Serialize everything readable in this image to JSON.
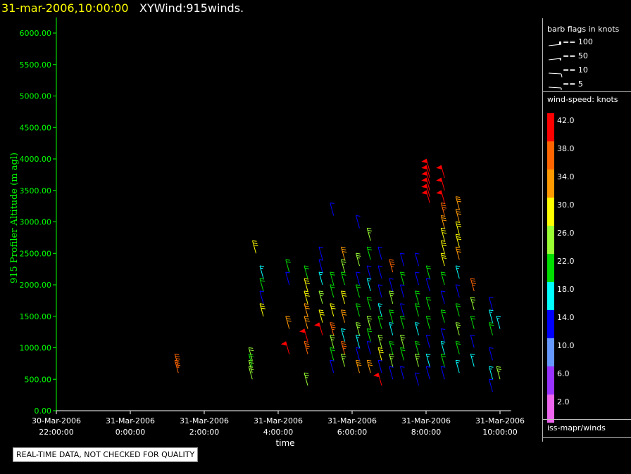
{
  "header": {
    "datetime": "31-mar-2006,10:00:00",
    "title": "XYWind:915winds."
  },
  "colors": {
    "axis": "#00ff00",
    "background": "#000000",
    "header_datetime": "#ffff00"
  },
  "legend": {
    "barb_title": "barb flags in knots",
    "barb_items": [
      "== 100",
      "== 50",
      "== 10",
      "== 5"
    ],
    "speed_title": "wind-speed: knots",
    "speed_scale": [
      {
        "label": "42.0",
        "color": "#ff0000"
      },
      {
        "label": "38.0",
        "color": "#ff6600"
      },
      {
        "label": "34.0",
        "color": "#ff9900"
      },
      {
        "label": "30.0",
        "color": "#ffff00"
      },
      {
        "label": "26.0",
        "color": "#99ff33"
      },
      {
        "label": "22.0",
        "color": "#00dd00"
      },
      {
        "label": "18.0",
        "color": "#00ffff"
      },
      {
        "label": "14.0",
        "color": "#0000ff"
      },
      {
        "label": "10.0",
        "color": "#6699ff"
      },
      {
        "label": "6.0",
        "color": "#9933ff"
      },
      {
        "label": "2.0",
        "color": "#ee66ee"
      }
    ],
    "source": "iss-mapr/winds"
  },
  "quality_note": "REAL-TIME DATA, NOT CHECKED FOR QUALITY",
  "chart_data": {
    "type": "scatter",
    "xlabel": "time",
    "ylabel": "915 Profiler Altitude (m agl)",
    "ylim": [
      0,
      6250
    ],
    "yticks": [
      0,
      500,
      1000,
      1500,
      2000,
      2500,
      3000,
      3500,
      4000,
      4500,
      5000,
      5500,
      6000
    ],
    "ytick_labels": [
      "0.00",
      "500.00",
      "1000.00",
      "1500.00",
      "2000.00",
      "2500.00",
      "3000.00",
      "3500.00",
      "4000.00",
      "4500.00",
      "5000.00",
      "5500.00",
      "6000.00"
    ],
    "xlim": [
      0,
      12.3
    ],
    "xticks": [
      {
        "hours": 0,
        "date": "30-Mar-2006",
        "time": "22:00:00"
      },
      {
        "hours": 2,
        "date": "31-Mar-2006",
        "time": "0:00:00"
      },
      {
        "hours": 4,
        "date": "31-Mar-2006",
        "time": "2:00:00"
      },
      {
        "hours": 6,
        "date": "31-Mar-2006",
        "time": "4:00:00"
      },
      {
        "hours": 8,
        "date": "31-Mar-2006",
        "time": "6:00:00"
      },
      {
        "hours": 10,
        "date": "31-Mar-2006",
        "time": "8:00:00"
      },
      {
        "hours": 12,
        "date": "31-Mar-2006",
        "time": "10:00:00"
      }
    ],
    "series": [
      {
        "time": 3.3,
        "altitudes": [
          600,
          700
        ],
        "speeds": [
          36,
          36
        ]
      },
      {
        "time": 5.3,
        "altitudes": [
          500,
          600,
          700,
          800
        ],
        "speeds": [
          24,
          24,
          22,
          24
        ]
      },
      {
        "time": 5.4,
        "altitudes": [
          2500
        ],
        "speeds": [
          30
        ]
      },
      {
        "time": 5.6,
        "altitudes": [
          1500,
          1700,
          1900,
          2100
        ],
        "speeds": [
          30,
          14,
          22,
          18
        ]
      },
      {
        "time": 6.3,
        "altitudes": [
          900,
          1300,
          2000,
          2200
        ],
        "speeds": [
          42,
          34,
          14,
          20
        ]
      },
      {
        "time": 6.8,
        "altitudes": [
          400,
          900,
          1100,
          1300,
          1500,
          1700,
          1900,
          2100
        ],
        "speeds": [
          26,
          36,
          42,
          34,
          34,
          30,
          30,
          22
        ]
      },
      {
        "time": 7.2,
        "altitudes": [
          1200,
          1400,
          1700,
          2000,
          2200,
          2400
        ],
        "speeds": [
          42,
          30,
          26,
          18,
          14,
          14
        ]
      },
      {
        "time": 7.5,
        "altitudes": [
          600,
          800,
          1000,
          1200,
          1500,
          1800,
          2000,
          3100
        ],
        "speeds": [
          14,
          22,
          26,
          38,
          30,
          22,
          20,
          14
        ]
      },
      {
        "time": 7.8,
        "altitudes": [
          700,
          900,
          1100,
          1400,
          1700,
          2000,
          2200,
          2400
        ],
        "speeds": [
          26,
          38,
          18,
          34,
          30,
          22,
          26,
          34
        ]
      },
      {
        "time": 8.2,
        "altitudes": [
          600,
          800,
          1000,
          1200,
          1500,
          1800,
          2000,
          2300,
          2900
        ],
        "speeds": [
          34,
          14,
          18,
          26,
          22,
          20,
          14,
          26,
          14
        ]
      },
      {
        "time": 8.5,
        "altitudes": [
          600,
          900,
          1100,
          1300,
          1600,
          1900,
          2100,
          2400,
          2700
        ],
        "speeds": [
          34,
          14,
          22,
          26,
          22,
          18,
          14,
          22,
          26
        ]
      },
      {
        "time": 8.8,
        "altitudes": [
          400,
          600,
          800,
          1000,
          1300,
          1500,
          1800,
          2100,
          2400
        ],
        "speeds": [
          42,
          14,
          30,
          26,
          22,
          18,
          14,
          14,
          14
        ]
      },
      {
        "time": 9.1,
        "altitudes": [
          500,
          700,
          900,
          1200,
          1400,
          1700,
          1900,
          2200
        ],
        "speeds": [
          14,
          26,
          22,
          18,
          22,
          26,
          14,
          38
        ]
      },
      {
        "time": 9.4,
        "altitudes": [
          500,
          800,
          1000,
          1300,
          1500,
          1800,
          2000,
          2300
        ],
        "speeds": [
          14,
          22,
          26,
          22,
          14,
          14,
          22,
          14
        ]
      },
      {
        "time": 9.8,
        "altitudes": [
          400,
          700,
          900,
          1200,
          1500,
          1700,
          2000,
          2300
        ],
        "speeds": [
          14,
          26,
          22,
          18,
          22,
          22,
          14,
          14
        ]
      },
      {
        "time": 10.1,
        "altitudes": [
          500,
          700,
          1000,
          1300,
          1600,
          1900,
          2100,
          3300,
          3400,
          3500,
          3600,
          3700,
          3800
        ],
        "speeds": [
          14,
          18,
          14,
          22,
          22,
          14,
          22,
          42,
          42,
          42,
          42,
          42,
          42
        ]
      },
      {
        "time": 10.5,
        "altitudes": [
          500,
          700,
          900,
          1100,
          1400,
          1700,
          2000,
          2300,
          2500,
          2700,
          2900,
          3100,
          3300,
          3500,
          3700
        ],
        "speeds": [
          14,
          22,
          18,
          14,
          22,
          14,
          22,
          30,
          30,
          30,
          34,
          38,
          42,
          42,
          42
        ]
      },
      {
        "time": 10.9,
        "altitudes": [
          600,
          900,
          1200,
          1500,
          1800,
          2100,
          2400,
          2600,
          2800,
          3000,
          3200
        ],
        "speeds": [
          18,
          22,
          26,
          22,
          14,
          18,
          34,
          30,
          30,
          34,
          34
        ]
      },
      {
        "time": 11.3,
        "altitudes": [
          700,
          1000,
          1300,
          1600,
          1900
        ],
        "speeds": [
          18,
          14,
          22,
          26,
          38
        ]
      },
      {
        "time": 11.8,
        "altitudes": [
          300,
          500,
          800,
          1200,
          1400,
          1600
        ],
        "speeds": [
          14,
          18,
          14,
          22,
          18,
          14
        ]
      },
      {
        "time": 12.0,
        "altitudes": [
          500,
          1300
        ],
        "speeds": [
          26,
          18
        ]
      }
    ]
  }
}
